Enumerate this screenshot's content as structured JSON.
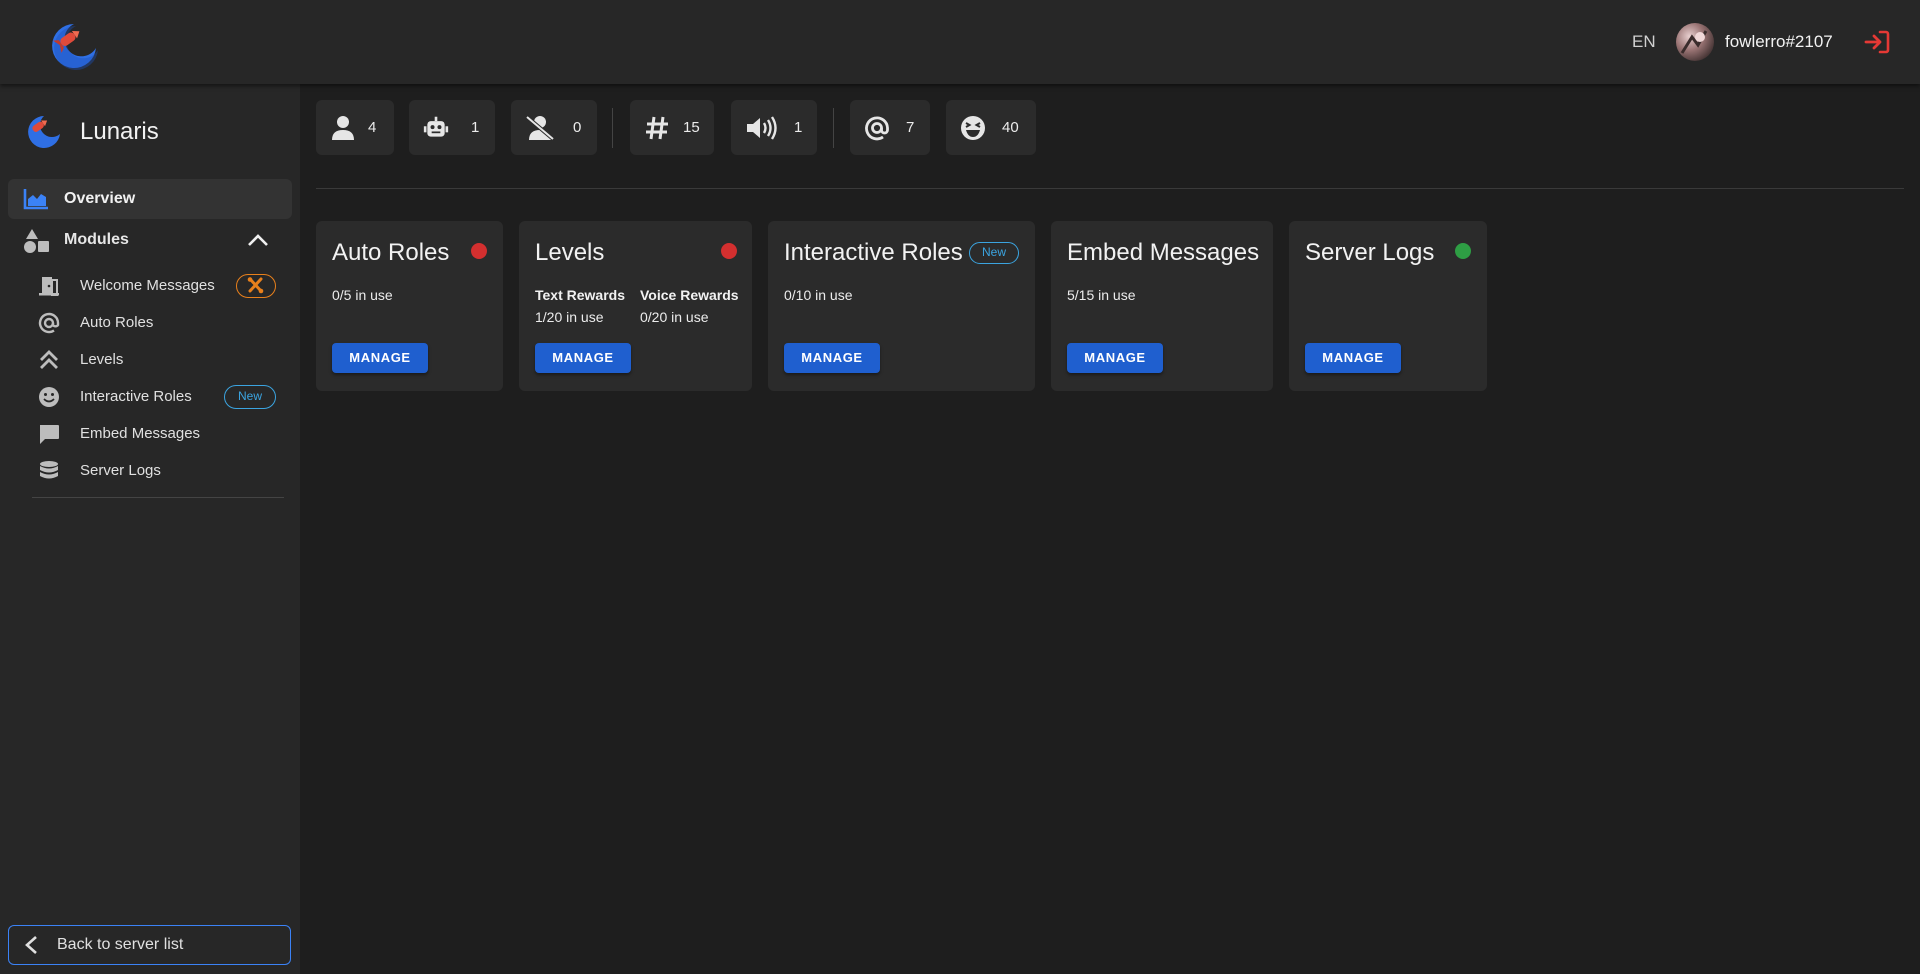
{
  "header": {
    "language": "EN",
    "username": "fowlerro#2107"
  },
  "server": {
    "name": "Lunaris"
  },
  "sidebar": {
    "overview_label": "Overview",
    "modules_label": "Modules",
    "modules": [
      {
        "label": "Welcome Messages",
        "icon": "door-open-icon",
        "badge": "tools"
      },
      {
        "label": "Auto Roles",
        "icon": "at-icon"
      },
      {
        "label": "Levels",
        "icon": "double-chevron-up-icon"
      },
      {
        "label": "Interactive Roles",
        "icon": "smile-icon",
        "badge": "New"
      },
      {
        "label": "Embed Messages",
        "icon": "chat-bubble-icon"
      },
      {
        "label": "Server Logs",
        "icon": "database-icon"
      }
    ],
    "back_label": "Back to server list"
  },
  "stats": {
    "members": "4",
    "bots": "1",
    "offline": "0",
    "text_channels": "15",
    "voice_channels": "1",
    "roles": "7",
    "emojis": "40"
  },
  "cards": {
    "auto_roles": {
      "title": "Auto Roles",
      "usage": "0/5 in use",
      "status": "disabled",
      "button": "MANAGE"
    },
    "levels": {
      "title": "Levels",
      "status": "disabled",
      "button": "MANAGE",
      "text_rewards_label": "Text Rewards",
      "text_rewards_usage": "1/20 in use",
      "voice_rewards_label": "Voice Rewards",
      "voice_rewards_usage": "0/20 in use"
    },
    "interactive_roles": {
      "title": "Interactive Roles",
      "badge": "New",
      "usage": "0/10 in use",
      "button": "MANAGE"
    },
    "embed_messages": {
      "title": "Embed Messages",
      "usage": "5/15 in use",
      "button": "MANAGE"
    },
    "server_logs": {
      "title": "Server Logs",
      "status": "enabled",
      "button": "MANAGE"
    }
  },
  "colors": {
    "accent_blue": "#1f5fcf",
    "status_red": "#d32f2f",
    "status_green": "#2e9e44",
    "badge_orange": "#e8801c",
    "badge_blue": "#3ba4e0"
  }
}
